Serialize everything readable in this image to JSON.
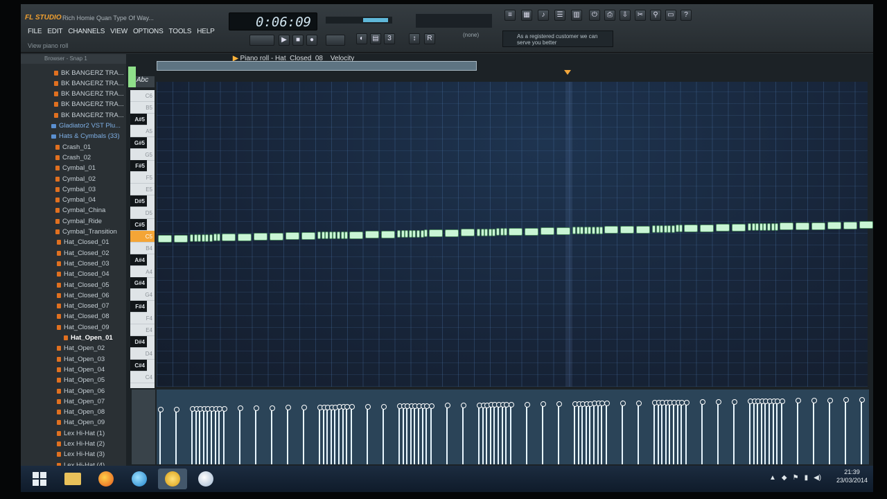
{
  "app": {
    "logo": "FL STUDIO",
    "project_title": "Rich Homie Quan Type Of Way..."
  },
  "menu": [
    "FILE",
    "EDIT",
    "CHANNELS",
    "VIEW",
    "OPTIONS",
    "TOOLS",
    "HELP"
  ],
  "hint": "View piano roll",
  "transport": {
    "time": "0:06:09",
    "snap": "(none)"
  },
  "news": "As a registered customer we can serve you better",
  "browser": {
    "header": "Browser - Snap 1",
    "items": [
      "BK BANGERZ TRA...",
      "BK BANGERZ TRA...",
      "BK BANGERZ TRA...",
      "BK BANGERZ TRA...",
      "BK BANGERZ TRA...",
      "Gladiator2 VST Plu...",
      "Hats & Cymbals (33)",
      "Crash_01",
      "Crash_02",
      "Cymbal_01",
      "Cymbal_02",
      "Cymbal_03",
      "Cymbal_04",
      "Cymbal_China",
      "Cymbal_Ride",
      "Cymbal_Transition",
      "Hat_Closed_01",
      "Hat_Closed_02",
      "Hat_Closed_03",
      "Hat_Closed_04",
      "Hat_Closed_05",
      "Hat_Closed_06",
      "Hat_Closed_07",
      "Hat_Closed_08",
      "Hat_Closed_09",
      "Hat_Open_01",
      "Hat_Open_02",
      "Hat_Open_03",
      "Hat_Open_04",
      "Hat_Open_05",
      "Hat_Open_06",
      "Hat_Open_07",
      "Hat_Open_08",
      "Hat_Open_09",
      "Lex Hi-Hat (1)",
      "Lex Hi-Hat (2)",
      "Lex Hi-Hat (3)",
      "Lex Hi-Hat (4)"
    ],
    "selected": "Hat_Open_01"
  },
  "pianoroll": {
    "title": "Piano roll - Hat_Closed_08",
    "target": "Velocity",
    "tool": "Abc",
    "note_label": "C5"
  },
  "keys": [
    "C6",
    "B5",
    "A#5",
    "A5",
    "G#5",
    "G5",
    "F#5",
    "F5",
    "E5",
    "D#5",
    "D5",
    "C#5",
    "C5",
    "B4",
    "A#4",
    "A4",
    "G#4",
    "G4",
    "F#4",
    "F4",
    "E4",
    "D#4",
    "D4",
    "C#4",
    "C4"
  ],
  "taskbar": {
    "time": "21:39",
    "date": "23/03/2014"
  },
  "colors": {
    "accent": "#f4a536",
    "note": "#c9f5d5",
    "grid": "#172438"
  }
}
